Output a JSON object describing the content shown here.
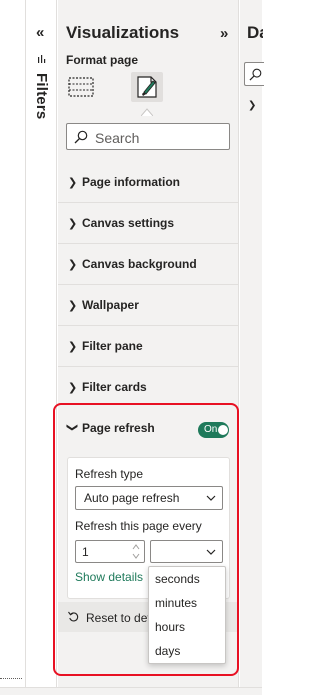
{
  "filters": {
    "collapse_glyph": "«",
    "label": "Filters"
  },
  "visualizations": {
    "title": "Visualizations",
    "expand_glyph": "»",
    "subtitle": "Format page",
    "search_placeholder": "Search",
    "sections": [
      {
        "label": "Page information"
      },
      {
        "label": "Canvas settings"
      },
      {
        "label": "Canvas background"
      },
      {
        "label": "Wallpaper"
      },
      {
        "label": "Filter pane"
      },
      {
        "label": "Filter cards"
      }
    ],
    "page_refresh": {
      "label": "Page refresh",
      "toggle_text": "On",
      "refresh_type_label": "Refresh type",
      "refresh_type_value": "Auto page refresh",
      "interval_label": "Refresh this page every",
      "interval_value": "1",
      "unit_value": "",
      "show_details": "Show details",
      "reset_label": "Reset to def",
      "unit_options": [
        "seconds",
        "minutes",
        "hours",
        "days"
      ]
    }
  },
  "data_pane": {
    "title": "Da"
  },
  "colors": {
    "accent_green": "#1f7a5b",
    "highlight_red": "#e81123",
    "pane_bg": "#f3f2f1"
  },
  "icons": [
    "filter-icon",
    "build-visual-icon",
    "format-page-icon",
    "search-icon",
    "chevron-right-icon",
    "chevron-down-icon",
    "reset-icon"
  ]
}
